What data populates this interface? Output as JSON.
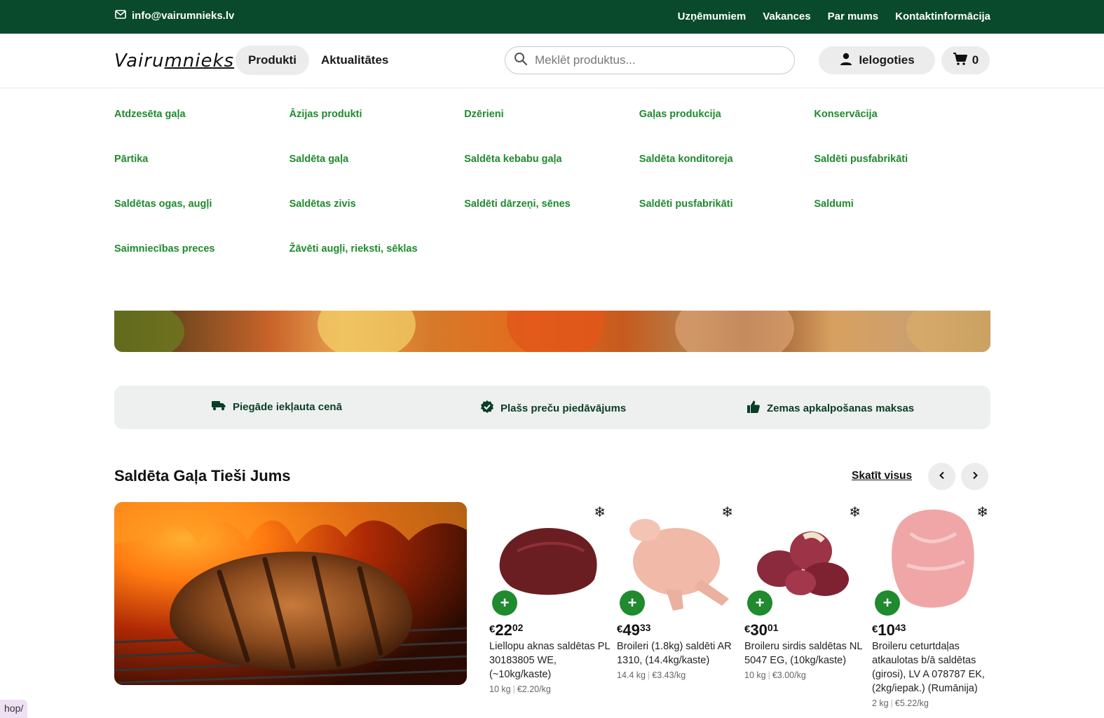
{
  "topbar": {
    "email": "info@vairumnieks.lv",
    "links": [
      "Uzņēmumiem",
      "Vakances",
      "Par mums",
      "Kontaktinformācija"
    ]
  },
  "header": {
    "logo": "Vairumnieks",
    "nav": {
      "products": "Produkti",
      "news": "Aktualitātes"
    },
    "search_placeholder": "Meklēt produktus...",
    "login": "Ielogoties",
    "cart_count": "0"
  },
  "categories": [
    "Atdzesēta gaļa",
    "Āzijas produkti",
    "Dzērieni",
    "Gaļas produkcija",
    "Konservācija",
    "Pārtika",
    "Saldēta gaļa",
    "Saldēta kebabu gaļa",
    "Saldēta konditoreja",
    "Saldēti pusfabrikāti",
    "Saldētas ogas, augļi",
    "Saldētas zivis",
    "Saldēti dārzeņi, sēnes",
    "Saldēti pusfabrikāti",
    "Saldumi",
    "Saimniecības preces",
    "Žāvēti augļi, rieksti, sēklas"
  ],
  "features": [
    {
      "label": "Piegāde iekļauta cenā",
      "icon": "truck-icon"
    },
    {
      "label": "Plašs preču piedāvājums",
      "icon": "verified-badge-icon"
    },
    {
      "label": "Zemas apkalpošanas maksas",
      "icon": "thumbs-up-icon"
    }
  ],
  "section": {
    "title": "Saldēta Gaļa Tieši Jums",
    "view_all": "Skatīt visus"
  },
  "products": [
    {
      "currency": "€",
      "whole": "22",
      "cents": "02",
      "name": "Liellopu aknas saldētas PL 30183805 WE, (~10kg/kaste)",
      "weight": "10 kg",
      "unit_price": "€2.20/kg",
      "color": "#6b1e22"
    },
    {
      "currency": "€",
      "whole": "49",
      "cents": "33",
      "name": "Broileri (1.8kg) saldēti AR 1310, (14.4kg/kaste)",
      "weight": "14.4 kg",
      "unit_price": "€3.43/kg",
      "color": "#f0b9a8"
    },
    {
      "currency": "€",
      "whole": "30",
      "cents": "01",
      "name": "Broileru sirdis saldētas NL 5047 EG, (10kg/kaste)",
      "weight": "10 kg",
      "unit_price": "€3.00/kg",
      "color": "#8a2a3c"
    },
    {
      "currency": "€",
      "whole": "10",
      "cents": "43",
      "name": "Broileru ceturtdaļas atkaulotas b/ā saldētas (girosi), LV A 078787 EK, (2kg/iepak.) (Rumānija)",
      "weight": "2 kg",
      "unit_price": "€5.22/kg",
      "color": "#f0a6a6"
    }
  ],
  "url_hint": "hop/",
  "colors": {
    "brand_dark": "#0a4a2c",
    "accent_green": "#1f8a2e"
  }
}
